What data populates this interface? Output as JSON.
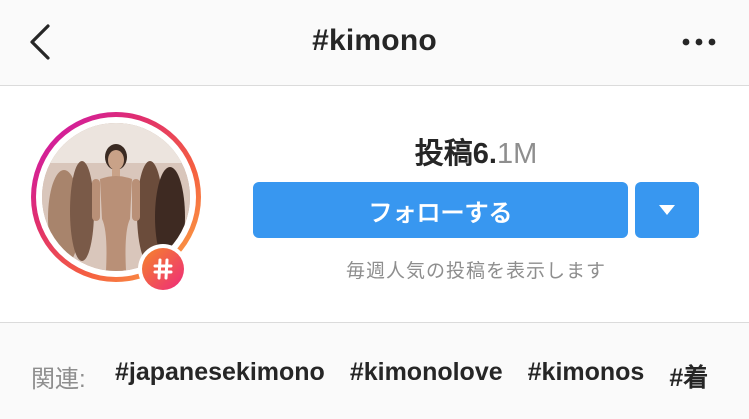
{
  "header": {
    "title": "#kimono",
    "back_icon": "chevron-left-icon",
    "more_icon": "ellipsis-icon"
  },
  "profile": {
    "post_label": "投稿",
    "post_count": "6.",
    "post_unit": "1M",
    "follow_label": "フォローする",
    "dropdown_icon": "caret-down-icon",
    "subtitle": "毎週人気の投稿を表示します",
    "badge_icon": "hashtag-icon"
  },
  "related": {
    "label": "関連:",
    "tags": [
      "#japanesekimono",
      "#kimonolove",
      "#kimonos",
      "#着"
    ]
  },
  "colors": {
    "accent": "#3897f0",
    "text": "#262626",
    "muted": "#8e8e8e"
  }
}
